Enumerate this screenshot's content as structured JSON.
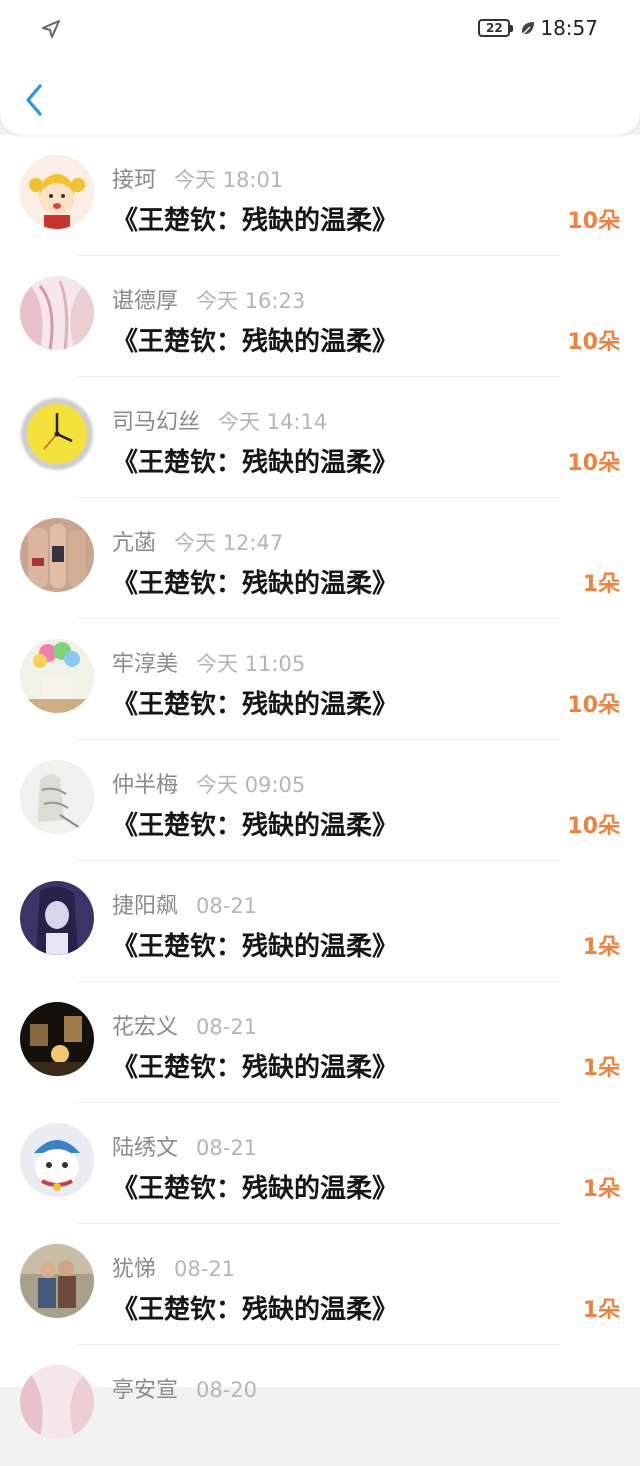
{
  "status_bar": {
    "battery": "22",
    "time": "18:57",
    "icons": [
      "location-arrow-icon",
      "battery-icon",
      "leaf-icon"
    ]
  },
  "header": {
    "back_icon": "chevron-left-icon"
  },
  "colors": {
    "accent": "#2196f3",
    "count": "#f0823e",
    "name": "#8a8a8a",
    "time": "#b5b5b5"
  },
  "items": [
    {
      "name": "接珂",
      "time": "今天 18:01",
      "title": "《王楚钦：残缺的温柔》",
      "count": "10朵",
      "avatar": "cartoon-girl"
    },
    {
      "name": "谌德厚",
      "time": "今天 16:23",
      "title": "《王楚钦：残缺的温柔》",
      "count": "10朵",
      "avatar": "pink-hair"
    },
    {
      "name": "司马幻丝",
      "time": "今天 14:14",
      "title": "《王楚钦：残缺的温柔》",
      "count": "10朵",
      "avatar": "yellow-clock"
    },
    {
      "name": "亢菡",
      "time": "今天 12:47",
      "title": "《王楚钦：残缺的温柔》",
      "count": "1朵",
      "avatar": "hands"
    },
    {
      "name": "牢淳美",
      "time": "今天 11:05",
      "title": "《王楚钦：残缺的温柔》",
      "count": "10朵",
      "avatar": "balloons"
    },
    {
      "name": "仲半梅",
      "time": "今天 09:05",
      "title": "《王楚钦：残缺的温柔》",
      "count": "10朵",
      "avatar": "sketch"
    },
    {
      "name": "捷阳飙",
      "time": "08-21",
      "title": "《王楚钦：残缺的温柔》",
      "count": "1朵",
      "avatar": "anime-purple"
    },
    {
      "name": "花宏义",
      "time": "08-21",
      "title": "《王楚钦：残缺的温柔》",
      "count": "1朵",
      "avatar": "dark-lamp"
    },
    {
      "name": "陆绣文",
      "time": "08-21",
      "title": "《王楚钦：残缺的温柔》",
      "count": "1朵",
      "avatar": "cat"
    },
    {
      "name": "犹悌",
      "time": "08-21",
      "title": "《王楚钦：残缺的温柔》",
      "count": "1朵",
      "avatar": "couple"
    },
    {
      "name": "亭安宣",
      "time": "08-20",
      "title": "",
      "count": "",
      "avatar": "pink-hair"
    }
  ]
}
